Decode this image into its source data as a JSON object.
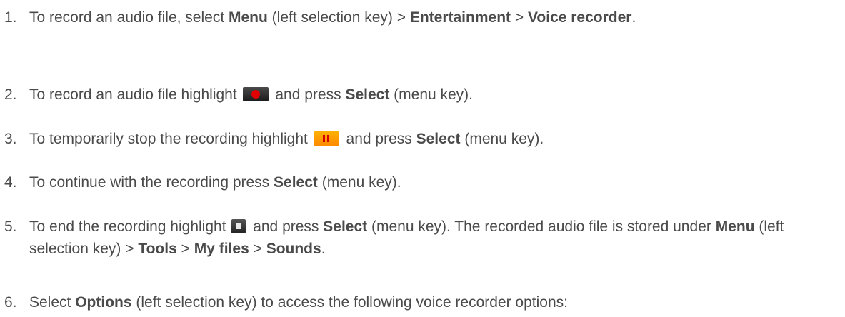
{
  "steps": [
    {
      "num": "1.",
      "parts": [
        {
          "t": "To record an audio file, select "
        },
        {
          "b": "Menu"
        },
        {
          "t": " (left selection key) > "
        },
        {
          "b": "Entertainment"
        },
        {
          "t": " > "
        },
        {
          "b": "Voice recorder"
        },
        {
          "t": "."
        }
      ]
    },
    {
      "num": "2.",
      "parts": [
        {
          "t": "To record an audio file highlight "
        },
        {
          "icon": "record-icon"
        },
        {
          "t": " and press "
        },
        {
          "b": "Select"
        },
        {
          "t": " (menu key)."
        }
      ]
    },
    {
      "num": "3.",
      "parts": [
        {
          "t": "To temporarily stop the recording highlight "
        },
        {
          "icon": "pause-icon"
        },
        {
          "t": " and press "
        },
        {
          "b": "Select"
        },
        {
          "t": " (menu key)."
        }
      ]
    },
    {
      "num": "4.",
      "parts": [
        {
          "t": "To continue with the recording press "
        },
        {
          "b": "Select"
        },
        {
          "t": " (menu key)."
        }
      ]
    },
    {
      "num": "5.",
      "parts": [
        {
          "t": "To end the recording highlight "
        },
        {
          "icon": "stop-icon"
        },
        {
          "t": " and press "
        },
        {
          "b": "Select"
        },
        {
          "t": " (menu key). The recorded audio file is stored under "
        },
        {
          "b": "Menu"
        },
        {
          "t": " (left selection key) > "
        },
        {
          "b": "Tools"
        },
        {
          "t": " > "
        },
        {
          "b": "My files"
        },
        {
          "t": " > "
        },
        {
          "b": "Sounds"
        },
        {
          "t": "."
        }
      ]
    },
    {
      "num": "6.",
      "parts": [
        {
          "t": "Select "
        },
        {
          "b": "Options"
        },
        {
          "t": " (left selection key) to access the following voice recorder options:"
        }
      ]
    }
  ]
}
